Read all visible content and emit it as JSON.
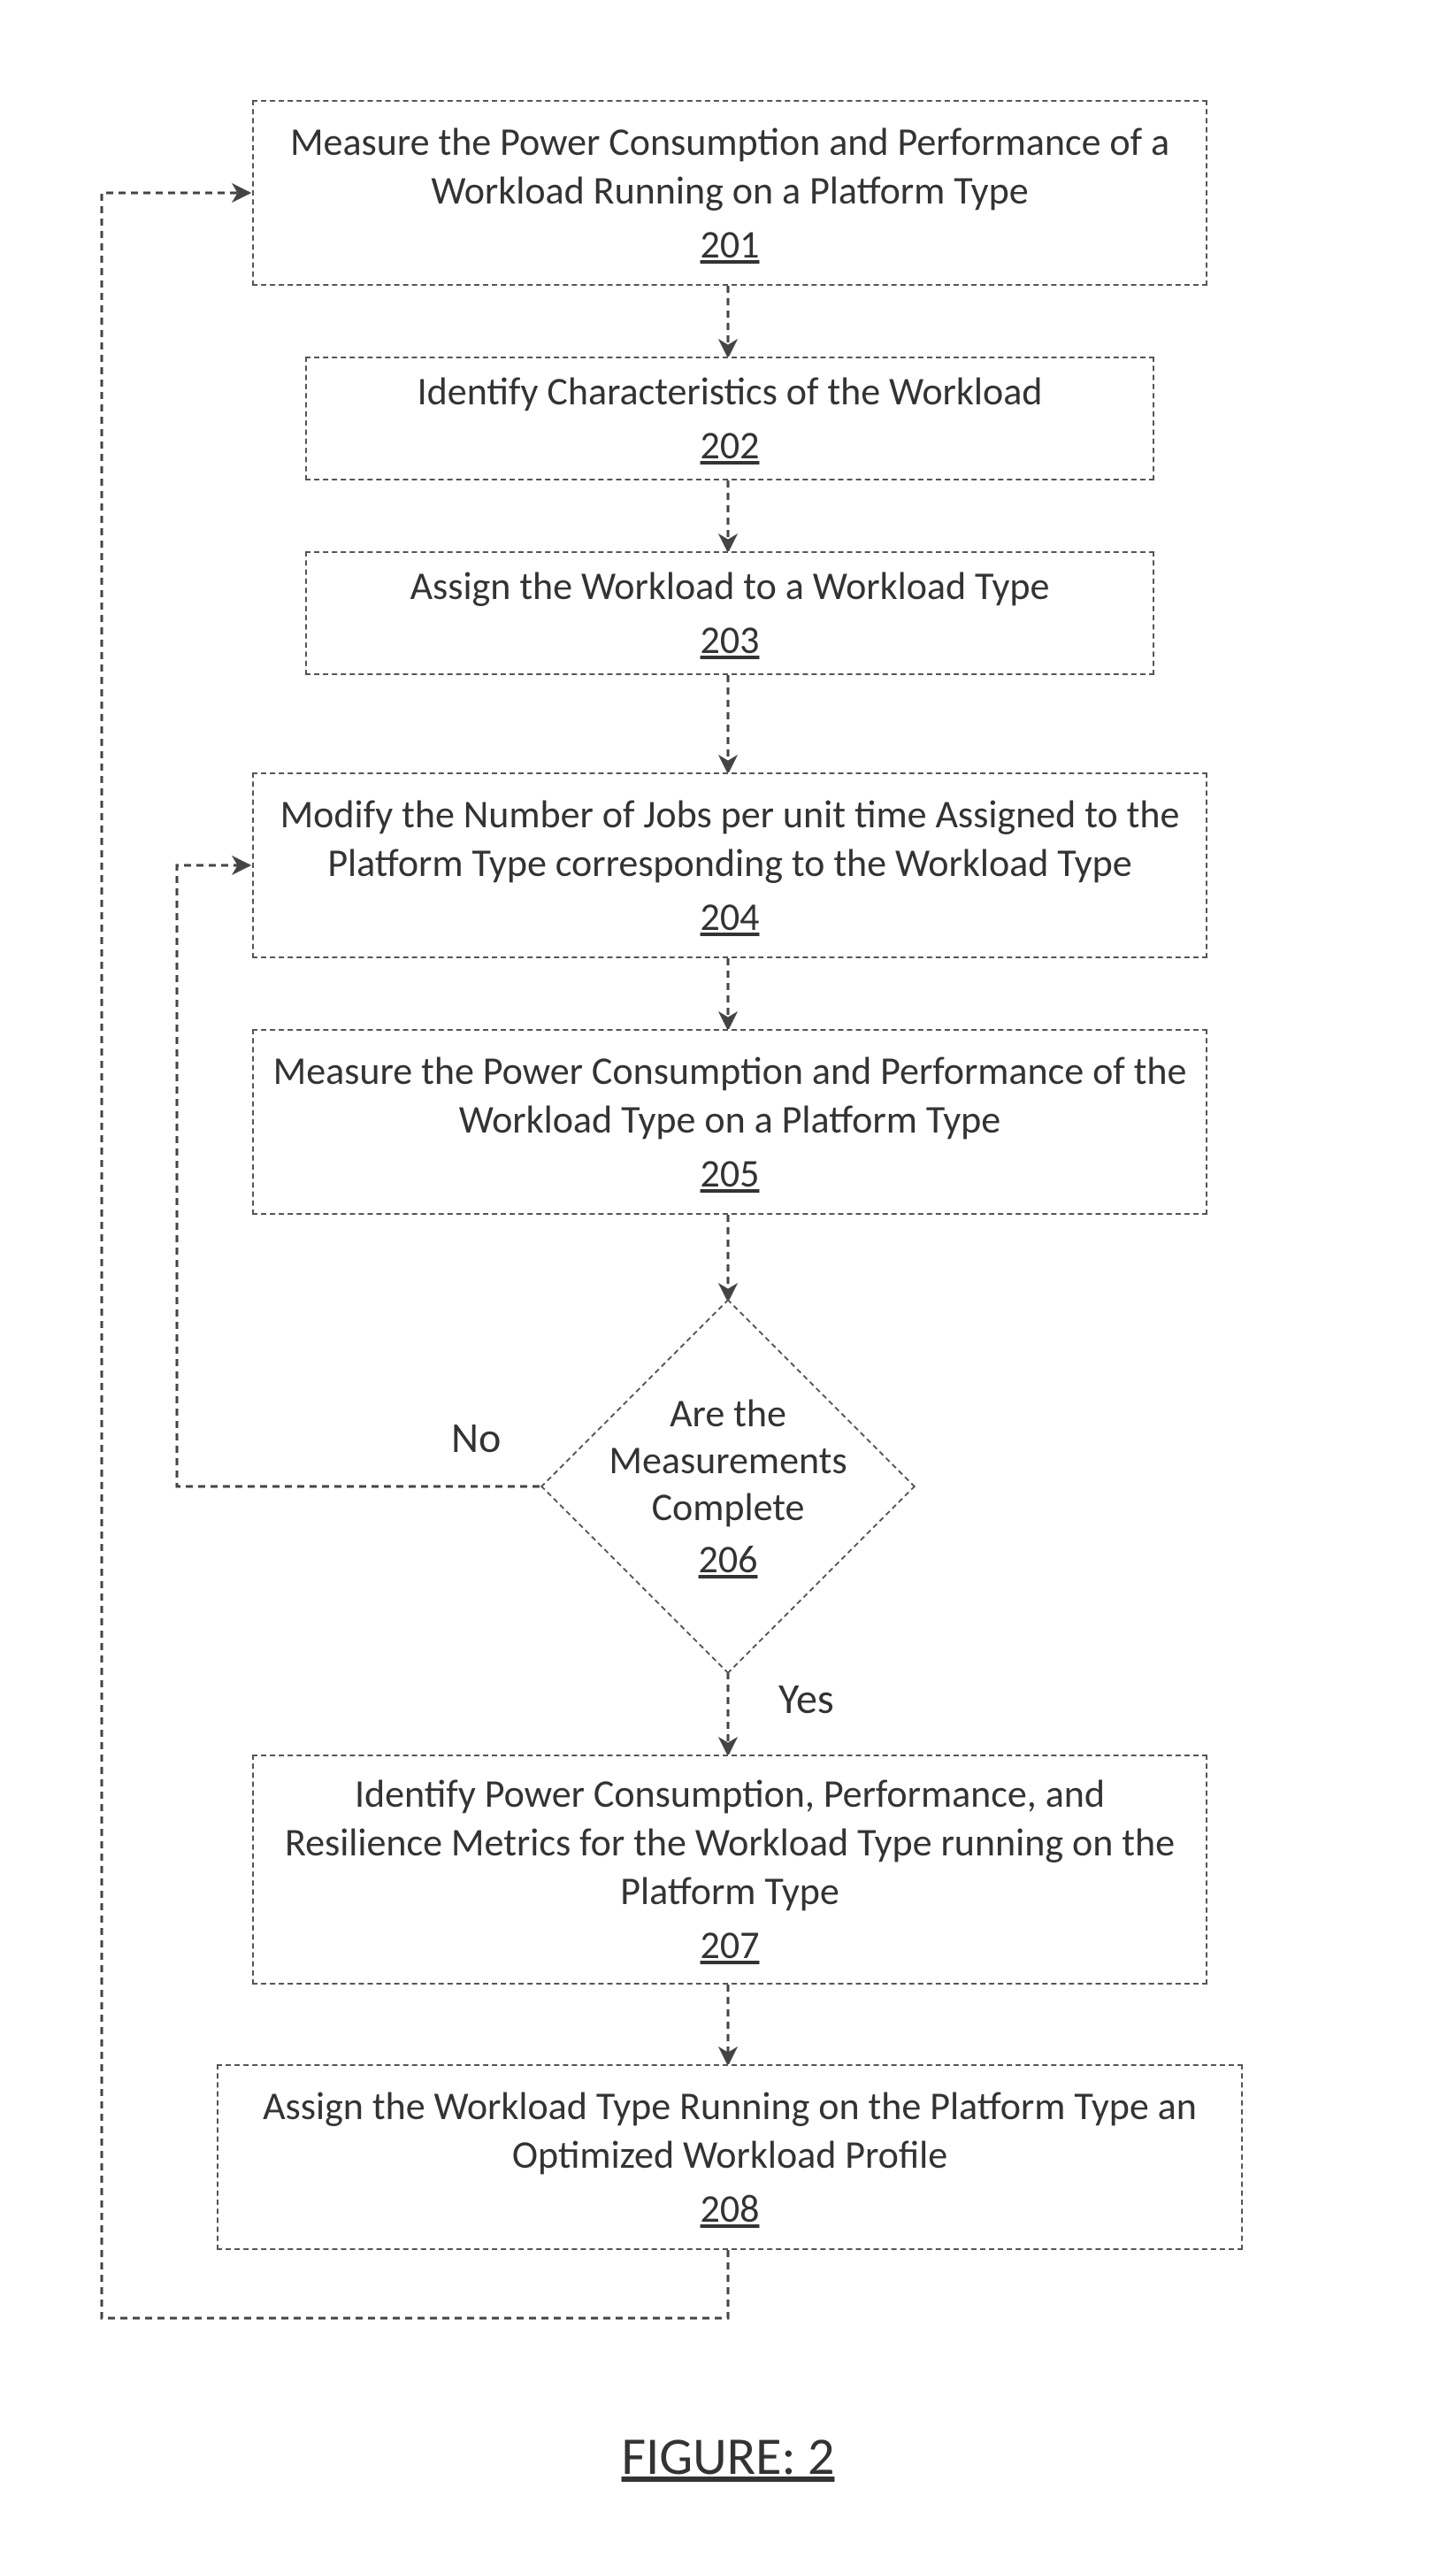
{
  "nodes": {
    "n201": {
      "text": "Measure the Power Consumption and Performance of a Workload Running on a Platform Type",
      "ref": "201"
    },
    "n202": {
      "text": "Identify Characteristics of the Workload",
      "ref": "202"
    },
    "n203": {
      "text": "Assign the Workload to a Workload Type",
      "ref": "203"
    },
    "n204": {
      "text": "Modify the Number of Jobs per unit time Assigned to the Platform Type corresponding to the Workload Type",
      "ref": "204"
    },
    "n205": {
      "text": "Measure the Power Consumption and Performance of the Workload Type on a Platform Type",
      "ref": "205"
    },
    "n206": {
      "text": "Are the Measurements Complete",
      "ref": "206"
    },
    "n207": {
      "text": "Identify Power Consumption, Performance, and Resilience Metrics for the Workload Type running on the Platform Type",
      "ref": "207"
    },
    "n208": {
      "text": "Assign the Workload Type Running on the Platform Type an Optimized Workload Profile",
      "ref": "208"
    }
  },
  "labels": {
    "no": "No",
    "yes": "Yes"
  },
  "caption": "FIGURE: 2"
}
